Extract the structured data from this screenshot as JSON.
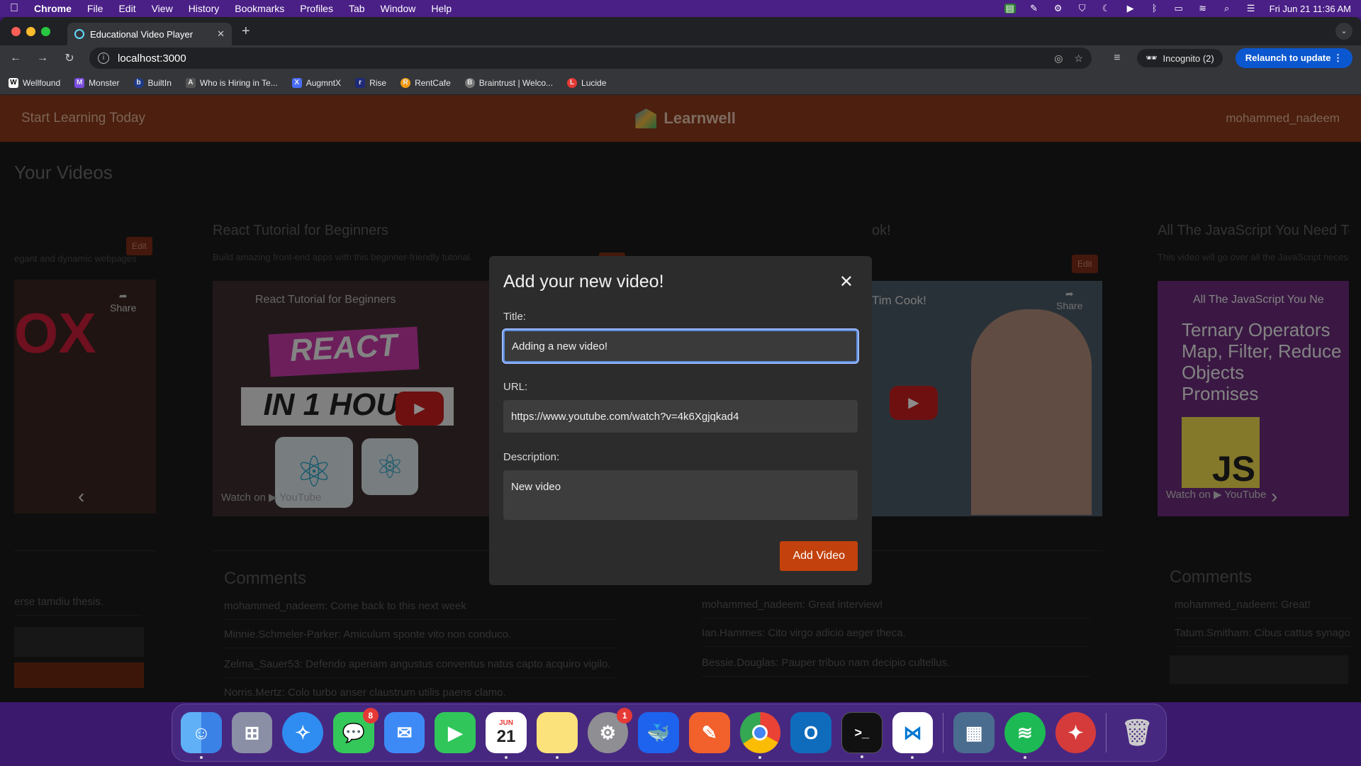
{
  "menubar": {
    "app": "Chrome",
    "items": [
      "File",
      "Edit",
      "View",
      "History",
      "Bookmarks",
      "Profiles",
      "Tab",
      "Window",
      "Help"
    ],
    "clock": "Fri Jun 21  11:36 AM"
  },
  "browser": {
    "tab_title": "Educational Video Player",
    "url": "localhost:3000",
    "incognito_label": "Incognito (2)",
    "relaunch_label": "Relaunch to update",
    "bookmarks": [
      {
        "label": "Wellfound",
        "icon": "W",
        "color": "#ffffff"
      },
      {
        "label": "Monster",
        "icon": "M",
        "color": "#7b4ce0"
      },
      {
        "label": "BuiltIn",
        "icon": "b",
        "color": "#1e3a8a"
      },
      {
        "label": "Who is Hiring in Te...",
        "icon": "A",
        "color": "#555555"
      },
      {
        "label": "AugmntX",
        "icon": "X",
        "color": "#4a6cf7"
      },
      {
        "label": "Rise",
        "icon": "r",
        "color": "#1e2a78"
      },
      {
        "label": "RentCafe",
        "icon": "R",
        "color": "#f39c12"
      },
      {
        "label": "Braintrust | Welco...",
        "icon": "B",
        "color": "#777777"
      },
      {
        "label": "Lucide",
        "icon": "L",
        "color": "#e53935"
      }
    ]
  },
  "app": {
    "tagline": "Start Learning Today",
    "brand": "Learnwell",
    "user": "mohammed_nadeem",
    "section_title": "Your Videos",
    "edit_label": "Edit",
    "comments_label": "Comments",
    "cards": [
      {
        "title": "",
        "desc": "egant and dynamic webpages",
        "comments": [
          "erse tamdiu thesis."
        ]
      },
      {
        "title": "React Tutorial for Beginners",
        "desc": "Build amazing front-end apps with this beginner-friendly tutorial.",
        "video_title": "React Tutorial for Beginners",
        "comments": [
          "mohammed_nadeem: Come back to this next week",
          "Minnie.Schmeler-Parker: Amiculum sponte vito non conduco.",
          "Zelma_Sauer53: Defendo aperiam angustus conventus natus capto acquiro vigilo.",
          "Norris.Mertz: Colo turbo anser claustrum utilis paens clamo."
        ]
      },
      {
        "title": "ok!",
        "desc": "",
        "video_title": "Tim Cook!",
        "comments": [
          "mohammed_nadeem: Great interview!",
          "Ian.Hammes: Cito virgo adicio aeger theca.",
          "Bessie.Douglas: Pauper tribuo nam decipio cultellus."
        ]
      },
      {
        "title": "All The JavaScript You Need To Kn",
        "desc": "This video will go over all the JavaScript necess",
        "video_title": "All The JavaScript You Ne",
        "comments": [
          "mohammed_nadeem: Great!",
          "Tatum.Smitham: Cibus cattus synago"
        ]
      }
    ],
    "share_label": "Share",
    "watch_on": "Watch on",
    "youtube": "YouTube"
  },
  "modal": {
    "heading": "Add your new video!",
    "title_label": "Title:",
    "title_value": "Adding a new video!",
    "url_label": "URL:",
    "url_value": "https://www.youtube.com/watch?v=4k6Xgjqkad4",
    "description_label": "Description:",
    "description_value": "New video",
    "submit_label": "Add Video"
  },
  "dock": {
    "messages_badge": "8",
    "settings_badge": "1",
    "calendar_month": "JUN",
    "calendar_day": "21"
  }
}
